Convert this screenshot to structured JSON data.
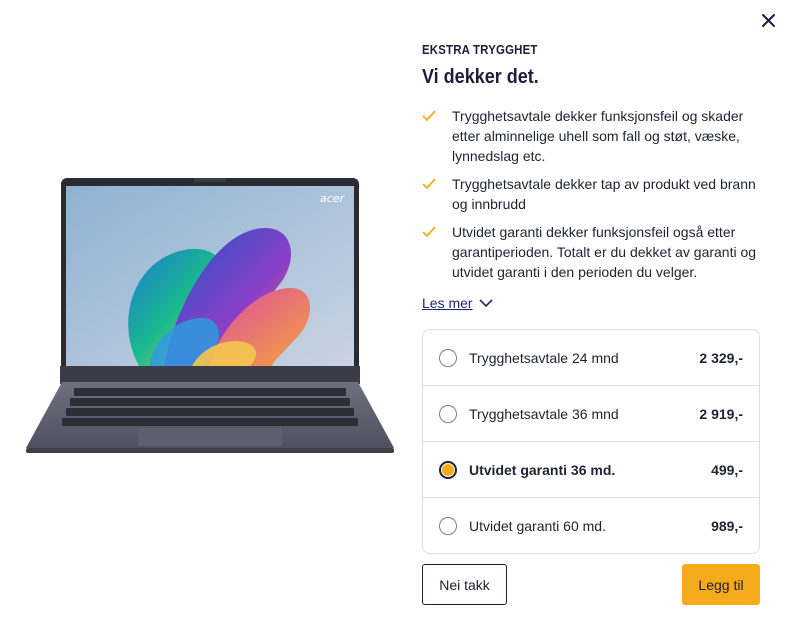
{
  "colors": {
    "accent": "#f6ac1a",
    "navy": "#1c1f3b",
    "link": "#1c2a6b",
    "check": "#f6ac1a"
  },
  "icons": {
    "close": "close-icon",
    "check": "check-icon",
    "chevron": "chevron-down-icon"
  },
  "product": {
    "brand_logo_text": "acer",
    "image": "laptop-image"
  },
  "panel": {
    "eyebrow": "EKSTRA TRYGGHET",
    "title": "Vi dekker det.",
    "benefits": [
      "Trygghetsavtale dekker funksjonsfeil og skader etter alminnelige uhell som fall og støt, væske, lynnedslag etc.",
      "Trygghetsavtale dekker tap av produkt ved brann og innbrudd",
      "Utvidet garanti dekker funksjonsfeil også etter garantiperioden. Totalt er du dekket av garanti og utvidet garanti i den perioden du velger."
    ],
    "read_more": "Les mer"
  },
  "options": [
    {
      "label": "Trygghetsavtale 24 mnd",
      "price": "2 329,-",
      "selected": false
    },
    {
      "label": "Trygghetsavtale 36 mnd",
      "price": "2 919,-",
      "selected": false
    },
    {
      "label": "Utvidet garanti 36 md.",
      "price": "499,-",
      "selected": true
    },
    {
      "label": "Utvidet garanti 60 md.",
      "price": "989,-",
      "selected": false
    }
  ],
  "actions": {
    "decline": "Nei takk",
    "add": "Legg til"
  }
}
